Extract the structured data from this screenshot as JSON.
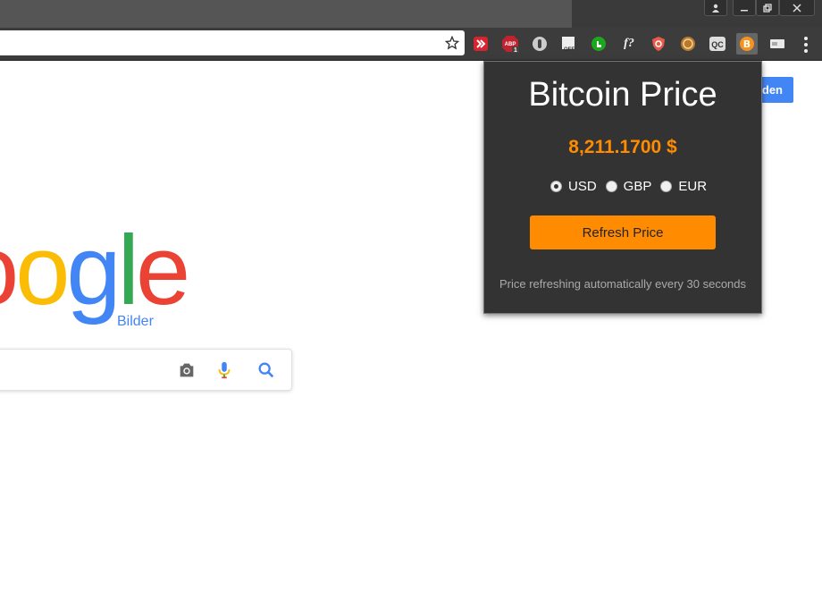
{
  "window": {
    "profile_icon": "person-icon",
    "minimize_label": "▁",
    "restore_label": "❐",
    "close_label": "✕"
  },
  "toolbar": {
    "bookmark_icon": "star-icon",
    "extensions": [
      {
        "name": "red-arrow-extension-icon",
        "label": "»"
      },
      {
        "name": "adblock-icon",
        "label": "ABP",
        "badge": "1"
      },
      {
        "name": "grey-circle-extension-icon",
        "label": ""
      },
      {
        "name": "off-extension-icon",
        "label": "OFF"
      },
      {
        "name": "green-hand-extension-icon",
        "label": ""
      },
      {
        "name": "font-finder-icon",
        "label": "f?"
      },
      {
        "name": "shield-extension-icon",
        "label": ""
      },
      {
        "name": "coin-extension-icon",
        "label": ""
      },
      {
        "name": "qc-extension-icon",
        "label": "QC"
      },
      {
        "name": "bitcoin-extension-icon",
        "label": "₿"
      },
      {
        "name": "card-extension-icon",
        "label": ""
      }
    ],
    "menu_icon": "more-vertical-icon"
  },
  "page": {
    "signin_label": "den",
    "logo_text_parts": [
      "o",
      "o",
      "g",
      "l",
      "e"
    ],
    "logo_sub": "Bilder"
  },
  "popup": {
    "title": "Bitcoin Price",
    "price": "8,211.1700 $",
    "currencies": [
      {
        "label": "USD",
        "checked": true
      },
      {
        "label": "GBP",
        "checked": false
      },
      {
        "label": "EUR",
        "checked": false
      }
    ],
    "refresh_label": "Refresh Price",
    "note": "Price refreshing automatically every 30 seconds"
  },
  "colors": {
    "accent": "#ff8c00",
    "popup_bg": "#333333",
    "google_blue": "#4285f4",
    "google_red": "#ea4335",
    "google_yellow": "#fbbc05",
    "google_green": "#34a853"
  }
}
